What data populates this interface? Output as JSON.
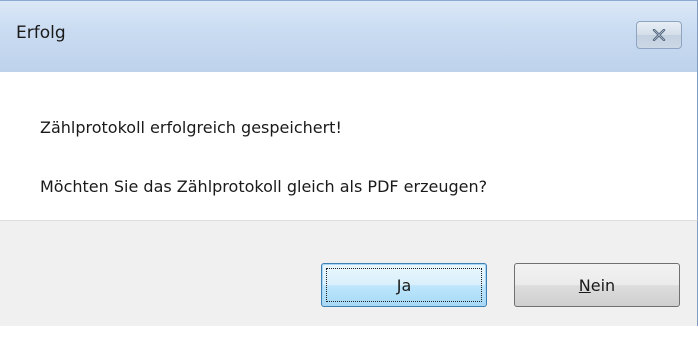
{
  "window": {
    "title": "Erfolg",
    "close_icon": "close-icon"
  },
  "content": {
    "message_line1": "Zählprotokoll erfolgreich gespeichert!",
    "message_line2": "Möchten Sie das Zählprotokoll gleich als PDF erzeugen?"
  },
  "buttons": {
    "yes": {
      "accel": "J",
      "rest": "a",
      "is_default": true
    },
    "no": {
      "accel": "N",
      "rest": "ein",
      "is_default": false
    }
  },
  "colors": {
    "titlebar": "#c9dbf1",
    "footer": "#f0f0f0",
    "default_button_border": "#3c7fb1"
  }
}
